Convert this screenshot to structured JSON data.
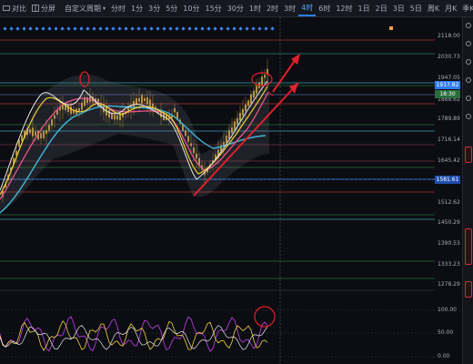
{
  "toolbar": {
    "compare_label": "对比",
    "split_label": "分屏",
    "custom_period_label": "自定义周期",
    "periods": [
      "分时",
      "1分",
      "3分",
      "5分",
      "10分",
      "15分",
      "30分",
      "1时",
      "2时",
      "3时",
      "4时",
      "6时",
      "12时",
      "1日",
      "2日",
      "3日",
      "5日",
      "周K",
      "月K",
      "季K"
    ],
    "active_period": "4时"
  },
  "price_axis": {
    "ticks": [
      "2118.00",
      "2030.73",
      "1947.05",
      "1868.62",
      "1789.89",
      "1716.14",
      "1645.42",
      "1581.61",
      "1512.62",
      "1450.29",
      "1390.53",
      "1333.23",
      "1278.29"
    ],
    "current_price": "1917.82",
    "countdown": "18:30",
    "marker_price": "1581.61"
  },
  "oscillator_axis": {
    "ticks": [
      "100.00",
      "50.00",
      "0.00"
    ]
  },
  "colors": {
    "background": "#0b0d12",
    "candle": "#c8a24a",
    "ma_white": "#e8e8e8",
    "ma_yellow": "#f2d13c",
    "ma_pink": "#e8548a",
    "ma_cyan": "#3fb6d8",
    "annotation_red": "#e1212a",
    "price_box": "#2f7df6",
    "countdown_box": "#2a6e3d"
  }
}
